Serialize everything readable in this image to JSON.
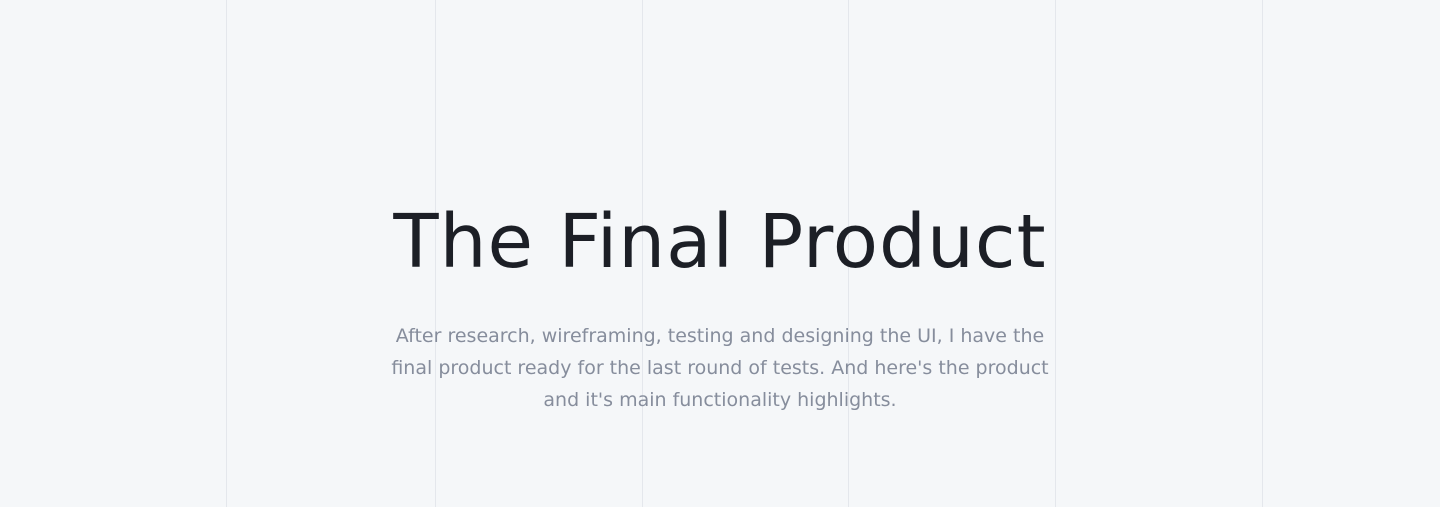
{
  "hero": {
    "title": "The Final Product",
    "subtitle": "After research, wireframing, testing and designing the UI, I have the final product ready for the last round of tests. And here's the product  and it's main functionality highlights."
  },
  "colors": {
    "background": "#f5f7f9",
    "grid_line": "#e4e7ec",
    "title": "#1c1f26",
    "subtitle": "#868d9c"
  }
}
